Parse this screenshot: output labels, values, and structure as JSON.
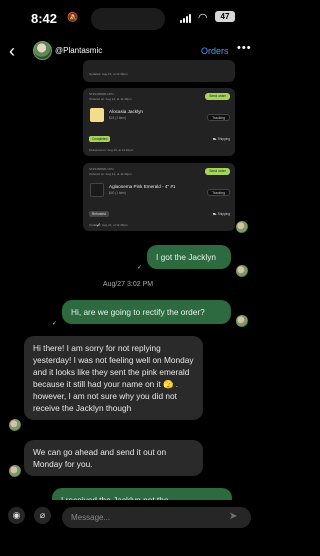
{
  "status": {
    "time": "8:42",
    "battery": "47"
  },
  "header": {
    "username": "@Plantasmic",
    "orders_label": "Orders"
  },
  "orders": [
    {
      "delivered": "Updated: Aug 16, at 11:46pm"
    },
    {
      "number": "ST#1466820-1071",
      "ordered": "Ordered on: Aug 12, at 11:46pm",
      "action": "Send order",
      "product": "Alocasia Jacklyn",
      "price": "$23 (1 item)",
      "tracking_badge": "Tracking",
      "status": "Completed",
      "shipping": "Shipping",
      "delivered": "Delivered on: Aug 16, at 11:46pm",
      "status_color": "#a4d45a"
    },
    {
      "number": "ST#1466820-1071",
      "ordered": "Ordered on: Aug 12, at 11:46pm",
      "action": "Send order",
      "product": "Aglaonema Pink Emerald - 4\" #1",
      "price": "$40 (1 item)",
      "tracking_badge": "Tracking",
      "status": "Refunded",
      "shipping": "Shipping",
      "delivered": "Updated: Aug 24, at 11:46pm",
      "status_color": "#888888"
    }
  ],
  "messages": [
    {
      "direction": "out",
      "text": "I got the Jacklyn"
    },
    {
      "direction": "out",
      "text": "Hi, are we going to rectify the order?"
    },
    {
      "direction": "in",
      "text": "Hi there! I am sorry for not replying yesterday!  I was not feeling well on Monday and it looks like they sent the pink emerald because it still had your name on it 🫣 .  however, I am not sure why you did not receive the Jacklyn though"
    },
    {
      "direction": "in",
      "text": "We can go ahead and send it out on Monday for you."
    },
    {
      "direction": "out",
      "text": "I received the Jacklyn not the"
    }
  ],
  "date_separator": "Aug/27 3:02 PM",
  "composer": {
    "placeholder": "Message..."
  },
  "colors": {
    "accent": "#4a9cf0",
    "outgoing_bubble": "#2d6a3f",
    "incoming_bubble": "#2a2a2a"
  }
}
